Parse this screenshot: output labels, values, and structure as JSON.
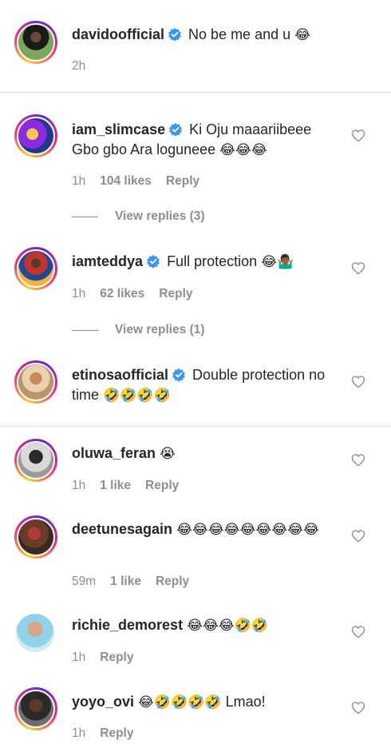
{
  "comments": [
    {
      "username": "davidoofficial",
      "verified": true,
      "text": "No be me and u",
      "emoji": "😂",
      "time": "2h",
      "likes": "",
      "reply": ""
    },
    {
      "username": "iam_slimcase",
      "verified": true,
      "text": "Ki Oju maaariibeee Gbo gbo Ara loguneee",
      "emoji": "😂😂😂",
      "time": "1h",
      "likes": "104 likes",
      "reply": "Reply",
      "view_replies": "View replies (3)"
    },
    {
      "username": "iamteddya",
      "verified": true,
      "text": "Full protection",
      "emoji": "😂🤷🏾‍♂️",
      "time": "1h",
      "likes": "62 likes",
      "reply": "Reply",
      "view_replies": "View replies (1)"
    },
    {
      "username": "etinosaofficial",
      "verified": true,
      "text": "Double protection no time",
      "emoji": "🤣🤣🤣🤣",
      "time": "",
      "likes": "",
      "reply": ""
    },
    {
      "username": "oluwa_feran",
      "verified": false,
      "text": "",
      "emoji": "😭",
      "time": "1h",
      "likes": "1 like",
      "reply": "Reply"
    },
    {
      "username": "deetunesagain",
      "verified": false,
      "text": "",
      "emoji": "😂😂😂😂😂😂😂😂😂",
      "time": "59m",
      "likes": "1 like",
      "reply": "Reply"
    },
    {
      "username": "richie_demorest",
      "verified": false,
      "text": "",
      "emoji": "😂😂😂🤣🤣",
      "time": "1h",
      "likes": "",
      "reply": "Reply"
    },
    {
      "username": "yoyo_ovi",
      "verified": false,
      "text": "Lmao!",
      "emoji": "😂🤣🤣🤣🤣",
      "time": "1h",
      "likes": "",
      "reply": "Reply"
    }
  ],
  "icons": {
    "verified": "verified-badge-icon",
    "like": "heart-outline-icon"
  },
  "colors": {
    "verified": "#3897f0",
    "meta": "#8e8e8e",
    "text": "#262626",
    "divider": "#dbdbdb"
  }
}
